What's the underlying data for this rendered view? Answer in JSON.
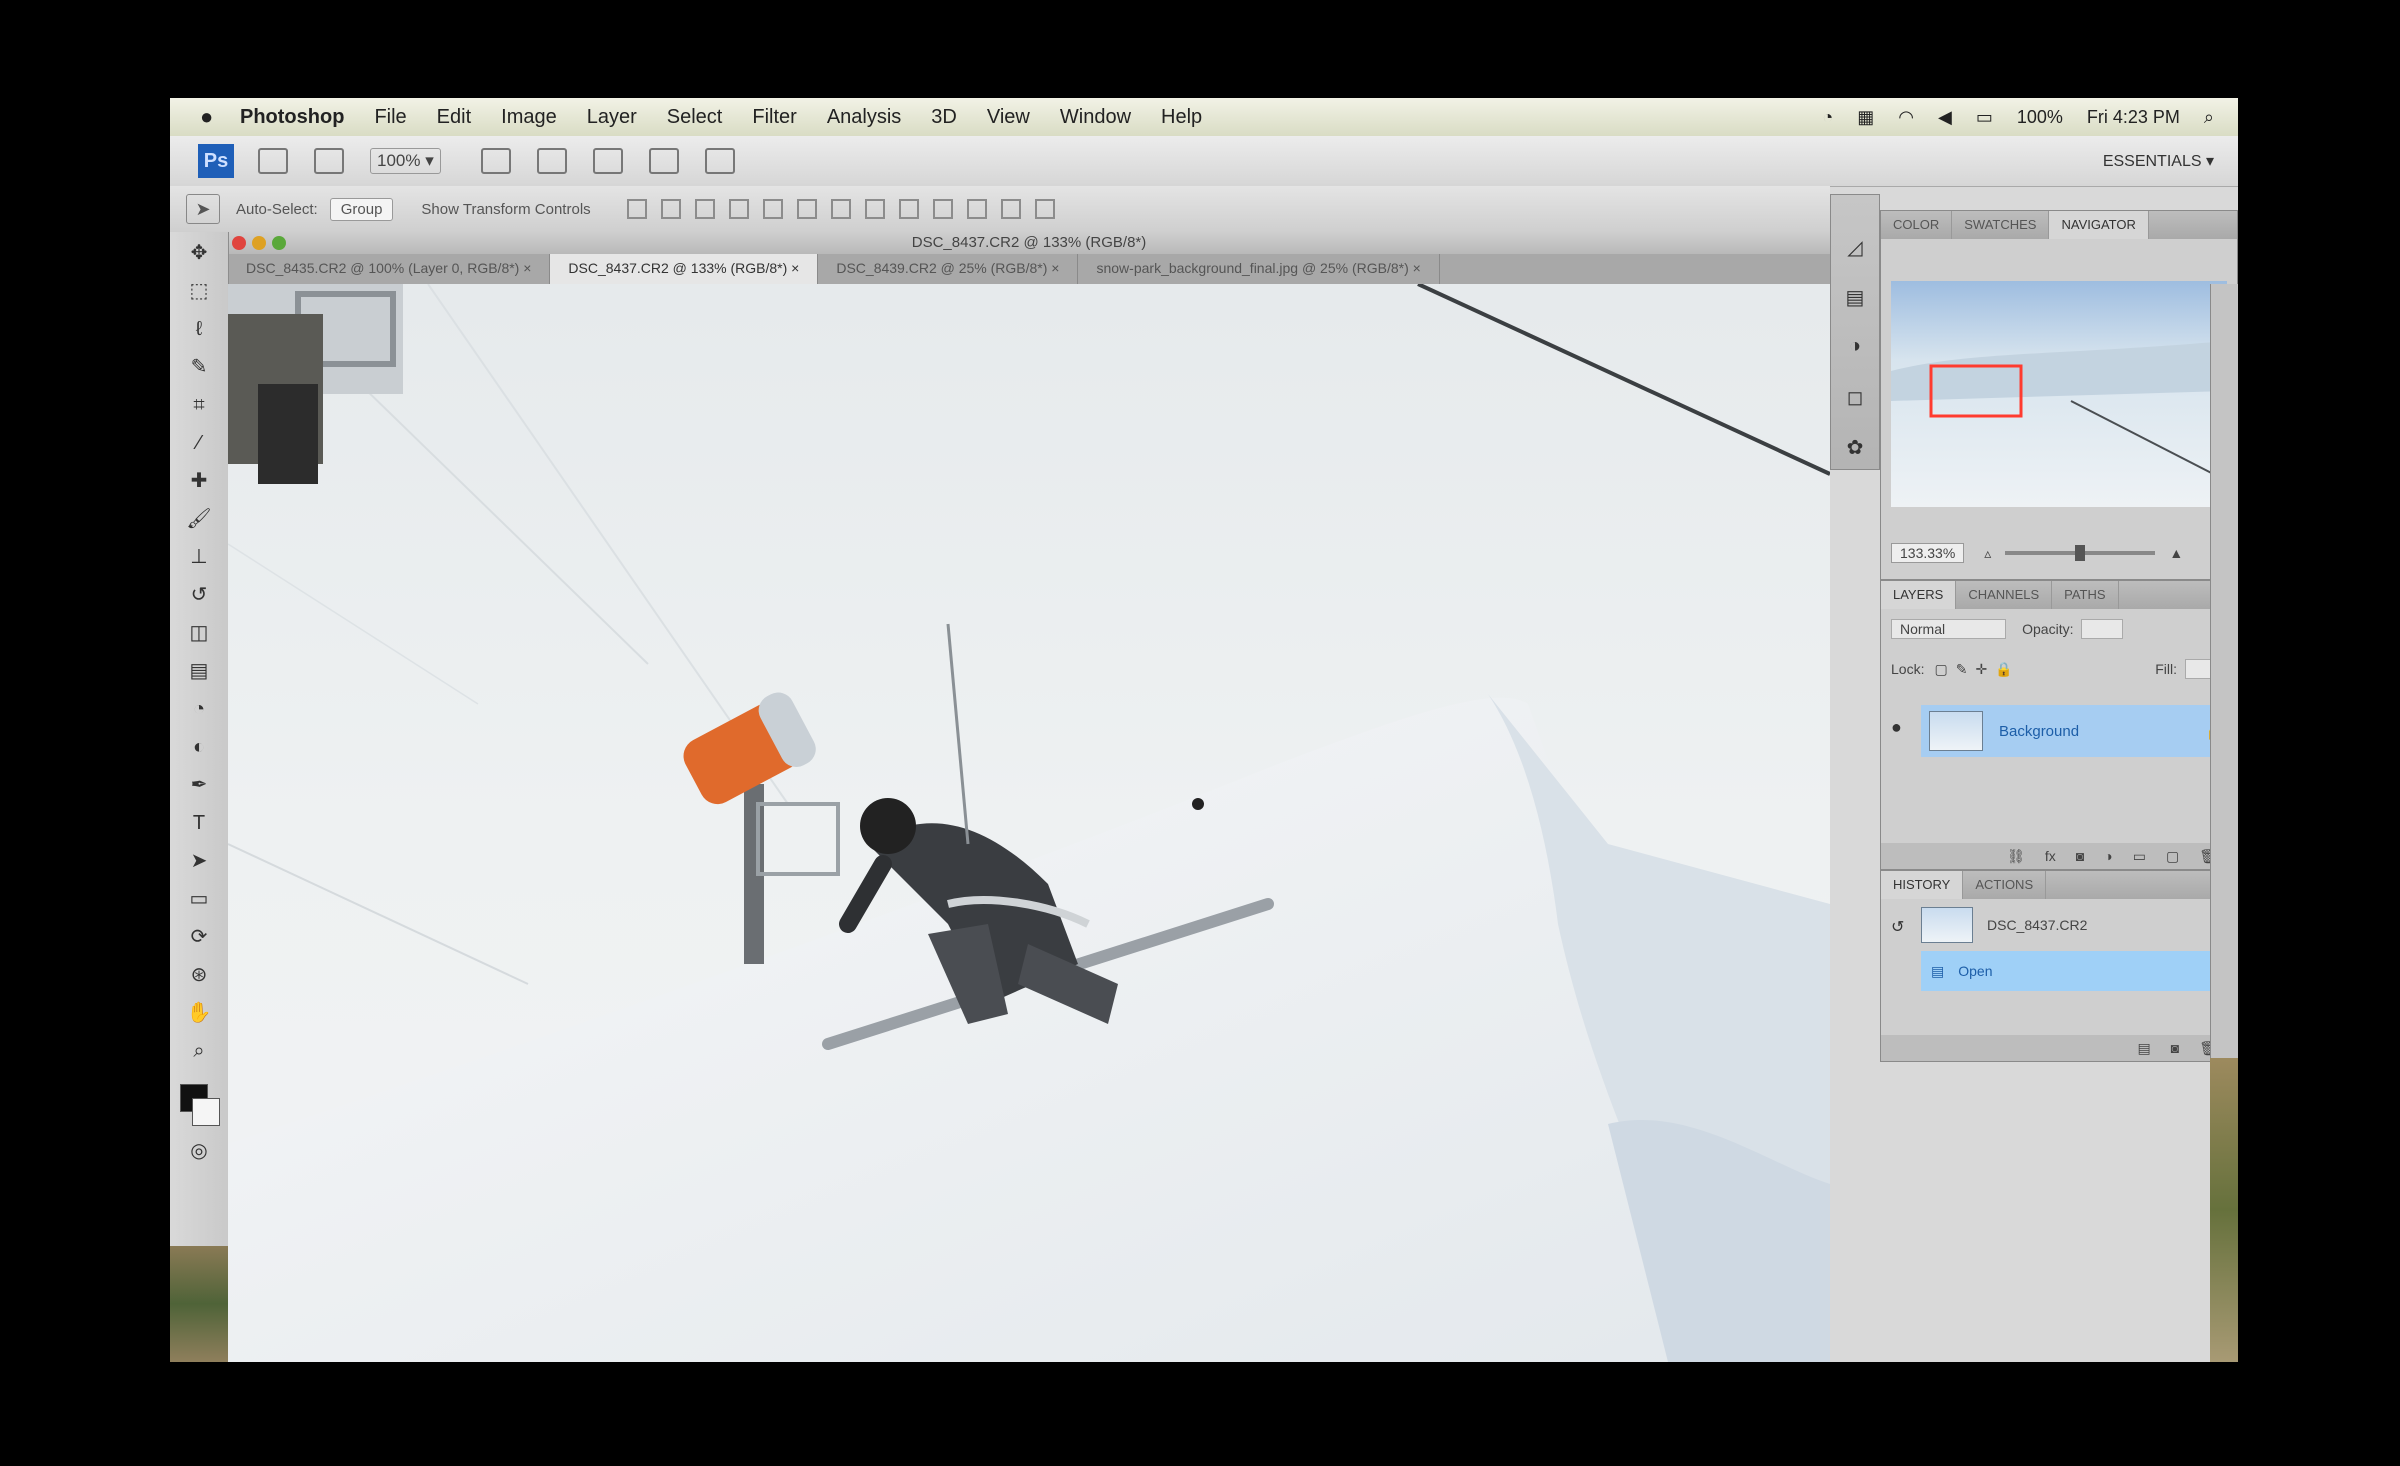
{
  "menubar": {
    "app_name": "Photoshop",
    "items": [
      "File",
      "Edit",
      "Image",
      "Layer",
      "Select",
      "Filter",
      "Analysis",
      "3D",
      "View",
      "Window",
      "Help"
    ],
    "battery": "100%",
    "clock": "Fri 4:23 PM"
  },
  "appbar": {
    "ps_label": "Ps",
    "zoom": "100% ▾",
    "workspace": "ESSENTIALS ▾"
  },
  "options": {
    "auto_select_label": "Auto-Select:",
    "auto_select_value": "Group",
    "show_transform_label": "Show Transform Controls"
  },
  "document": {
    "title": "DSC_8437.CR2 @ 133% (RGB/8*)",
    "tabs": [
      {
        "label": "DSC_8435.CR2 @ 100% (Layer 0, RGB/8*) ×",
        "active": false
      },
      {
        "label": "DSC_8437.CR2 @ 133% (RGB/8*) ×",
        "active": true
      },
      {
        "label": "DSC_8439.CR2 @ 25% (RGB/8*) ×",
        "active": false
      },
      {
        "label": "snow-park_background_final.jpg @ 25% (RGB/8*) ×",
        "active": false
      }
    ]
  },
  "navigator": {
    "tabs": [
      "COLOR",
      "SWATCHES",
      "NAVIGATOR"
    ],
    "zoom": "133.33%"
  },
  "layers_panel": {
    "tabs": [
      "LAYERS",
      "CHANNELS",
      "PATHS"
    ],
    "blend_mode": "Normal",
    "opacity_label": "Opacity:",
    "lock_label": "Lock:",
    "fill_label": "Fill:",
    "layer_name": "Background"
  },
  "history_panel": {
    "tabs": [
      "HISTORY",
      "ACTIONS"
    ],
    "snapshot": "DSC_8437.CR2",
    "state": "Open"
  },
  "colors": {
    "accent": "#1f5fb8",
    "selection": "#a6cdf2",
    "cannon": "#e06a2c"
  }
}
